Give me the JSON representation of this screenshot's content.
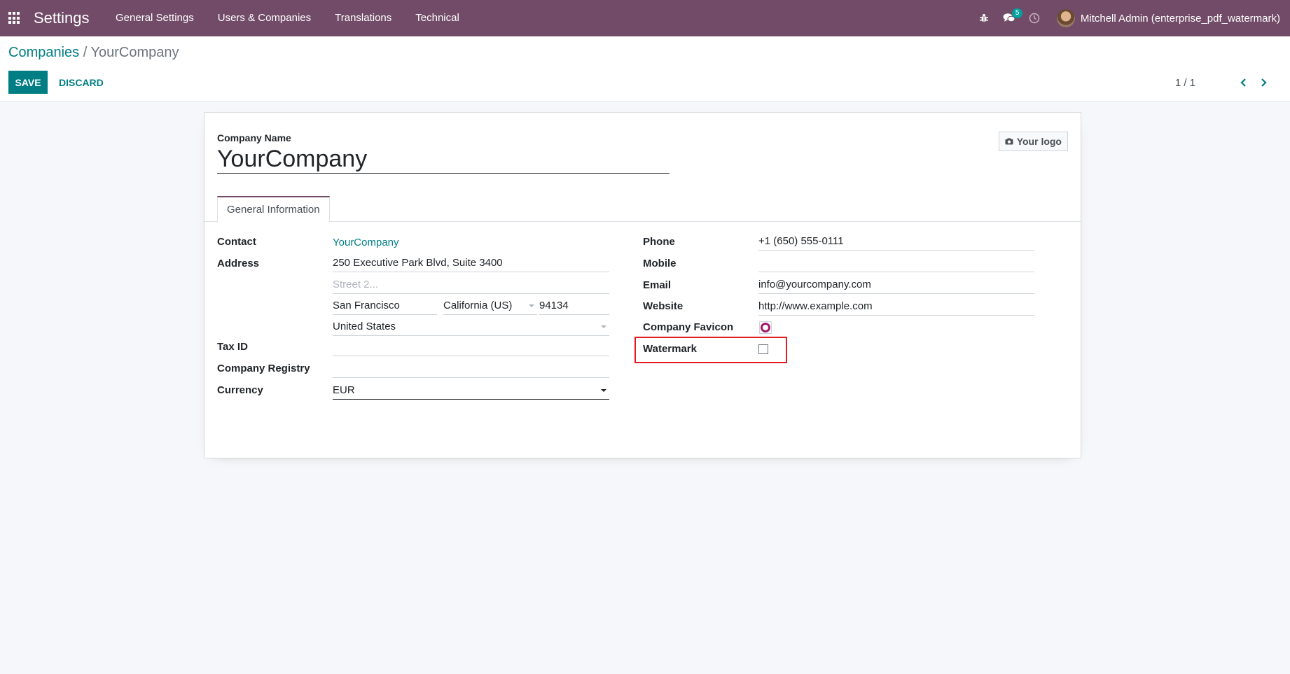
{
  "navbar": {
    "app_title": "Settings",
    "menu": [
      "General Settings",
      "Users & Companies",
      "Translations",
      "Technical"
    ],
    "messages_badge": "5",
    "user": "Mitchell Admin (enterprise_pdf_watermark)"
  },
  "breadcrumb": {
    "parent": "Companies",
    "separator": "/",
    "current": "YourCompany"
  },
  "actions": {
    "save": "SAVE",
    "discard": "DISCARD"
  },
  "pager": {
    "value": "1 / 1"
  },
  "form": {
    "company_name_label": "Company Name",
    "company_name": "YourCompany",
    "logo_button": "Your logo",
    "tab": "General Information",
    "left": {
      "contact_label": "Contact",
      "contact_value": "YourCompany",
      "address_label": "Address",
      "street": "250 Executive Park Blvd, Suite 3400",
      "street2_placeholder": "Street 2...",
      "city": "San Francisco",
      "state": "California (US)",
      "zip": "94134",
      "country": "United States",
      "tax_id_label": "Tax ID",
      "tax_id": "",
      "registry_label": "Company Registry",
      "registry": "",
      "currency_label": "Currency",
      "currency": "EUR"
    },
    "right": {
      "phone_label": "Phone",
      "phone": "+1 (650) 555-0111",
      "mobile_label": "Mobile",
      "mobile": "",
      "email_label": "Email",
      "email": "info@yourcompany.com",
      "website_label": "Website",
      "website": "http://www.example.com",
      "favicon_label": "Company Favicon",
      "watermark_label": "Watermark",
      "watermark_checked": false
    }
  },
  "colors": {
    "navbar": "#714b67",
    "primary": "#017e84",
    "highlight": "#e31b23"
  }
}
